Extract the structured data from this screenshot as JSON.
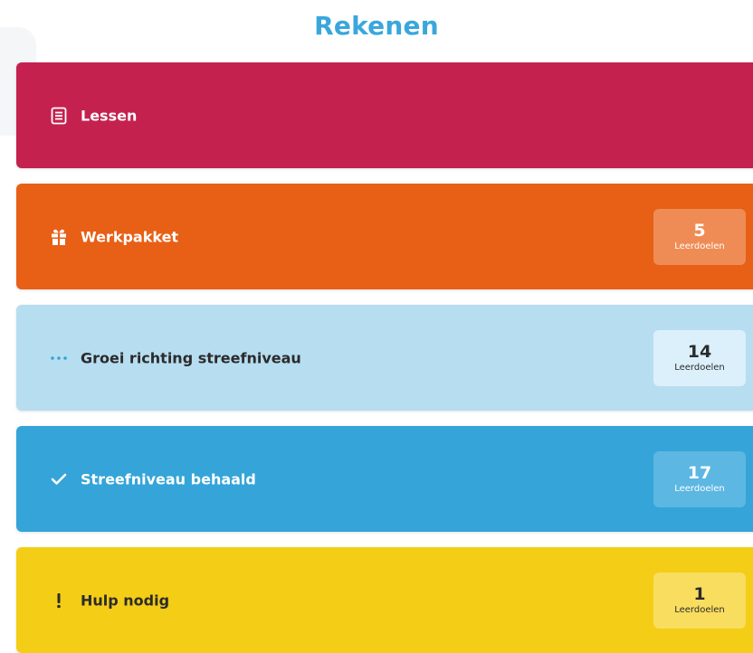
{
  "header": {
    "title": "Rekenen"
  },
  "cards": [
    {
      "label": "Lessen",
      "icon": "list-icon"
    },
    {
      "label": "Werkpakket",
      "icon": "gift-icon",
      "count": "5",
      "unit": "Leerdoelen"
    },
    {
      "label": "Groei richting streefniveau",
      "icon": "ellipsis-icon",
      "count": "14",
      "unit": "Leerdoelen"
    },
    {
      "label": "Streefniveau behaald",
      "icon": "checkmark-icon",
      "count": "17",
      "unit": "Leerdoelen"
    },
    {
      "label": "Hulp nodig",
      "icon": "exclamation-icon",
      "count": "1",
      "unit": "Leerdoelen"
    }
  ],
  "colors": {
    "title": "#3aa7dc",
    "lessen": "#c4214f",
    "werkpakket": "#e85f16",
    "groei": "#b7ddf1",
    "streefniveau": "#35a4d8",
    "hulp": "#f4cd16"
  }
}
